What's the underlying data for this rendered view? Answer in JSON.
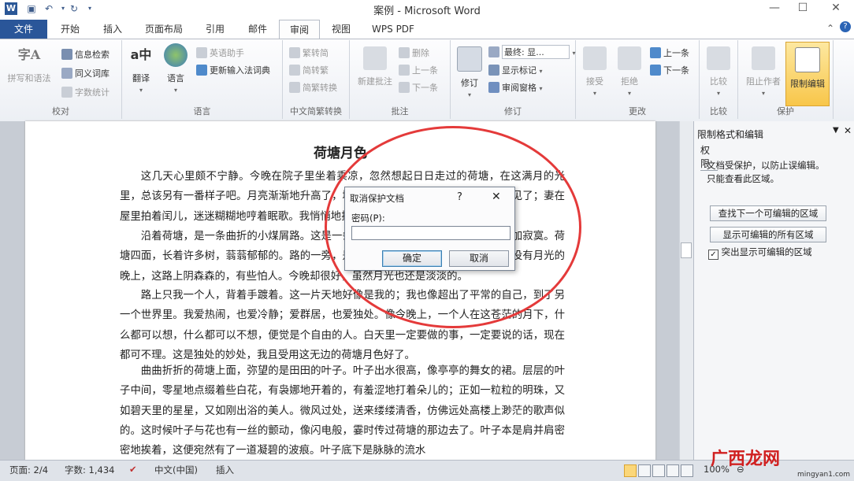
{
  "window": {
    "title": "案例 - Microsoft Word",
    "app_icon": "W",
    "minimize": "—",
    "maximize": "☐",
    "close": "✕"
  },
  "quick_access": {
    "save_icon": "save-icon",
    "undo_icon": "undo-icon",
    "repeat_icon": "repeat-icon"
  },
  "tabs": [
    "文件",
    "开始",
    "插入",
    "页面布局",
    "引用",
    "邮件",
    "审阅",
    "视图",
    "WPS PDF"
  ],
  "active_tab": "审阅",
  "ribbon": {
    "groups": {
      "proofing": "校对",
      "language": "语言",
      "chinese_conversion": "中文简繁转换",
      "comments": "批注",
      "tracking": "修订",
      "changes": "更改",
      "compare": "比较",
      "protect": "保护"
    },
    "proofing": {
      "spelling": "拼写和语法",
      "research": "信息检索",
      "thesaurus": "同义词库",
      "word_count": "字数统计"
    },
    "language": {
      "translate": "翻译",
      "language": "语言",
      "english_assistant": "英语助手",
      "update_ime": "更新输入法词典"
    },
    "conversion": {
      "to_simplified": "繁转简",
      "to_traditional": "简转繁",
      "convert": "简繁转换"
    },
    "comments": {
      "new_comment": "新建批注",
      "delete": "删除",
      "previous": "上一条",
      "next": "下一条"
    },
    "tracking": {
      "track_changes": "修订",
      "final_display": "最终: 显...",
      "show_markup": "显示标记",
      "review_pane": "审阅窗格"
    },
    "changes": {
      "accept": "接受",
      "reject": "拒绝",
      "previous": "上一条",
      "next": "下一条"
    },
    "compare": {
      "compare": "比较"
    },
    "protect": {
      "block_authors": "阻止作者",
      "restrict_editing": "限制编辑"
    }
  },
  "document": {
    "title": "荷塘月色",
    "paragraphs": [
      "这几天心里颇不宁静。今晚在院子里坐着乘凉，忽然想起日日走过的荷塘，在这满月的光里，总该另有一番样子吧。月亮渐渐地升高了，墙外马路上孩子们的欢笑，已经听不见了；妻在屋里拍着闰儿，迷迷糊糊地哼着眠歌。我悄悄地披了大衫，带上门出去。",
      "沿着荷塘，是一条曲折的小煤屑路。这是一条幽僻的路；白天也少人走，夜晚更加寂寞。荷塘四面，长着许多树，蓊蓊郁郁的。路的一旁，是些杨柳，和一些不知道名字的树。没有月光的晚上，这路上阴森森的，有些怕人。今晚却很好，虽然月光也还是淡淡的。",
      "路上只我一个人，背着手踱着。这一片天地好像是我的；我也像超出了平常的自己，到了另一个世界里。我爱热闹，也爱冷静；爱群居，也爱独处。像今晚上，一个人在这苍茫的月下，什么都可以想，什么都可以不想，便觉是个自由的人。白天里一定要做的事，一定要说的话，现在都可不理。这是独处的妙处，我且受用这无边的荷塘月色好了。",
      "曲曲折折的荷塘上面，弥望的是田田的叶子。叶子出水很高，像亭亭的舞女的裙。层层的叶子中间，零星地点缀着些白花，有袅娜地开着的，有羞涩地打着朵儿的；正如一粒粒的明珠，又如碧天里的星星，又如刚出浴的美人。微风过处，送来缕缕清香，仿佛远处高楼上渺茫的歌声似的。这时候叶子与花也有一丝的颤动，像闪电般，霎时传过荷塘的那边去了。叶子本是肩并肩密密地挨着，这便宛然有了一道凝碧的波痕。叶子底下是脉脉的流水"
    ]
  },
  "dialog": {
    "title": "取消保护文档",
    "help": "?",
    "close": "✕",
    "password_label": "密码(P):",
    "password_value": "",
    "ok": "确定",
    "cancel": "取消"
  },
  "task_pane": {
    "title": "限制格式和编辑",
    "section": "权限",
    "description_1": "文档受保护，以防止误编辑。",
    "description_2": "只能查看此区域。",
    "find_next_region": "查找下一个可编辑的区域",
    "show_all_regions": "显示可编辑的所有区域",
    "highlight_label": "突出显示可编辑的区域",
    "highlight_checked": true
  },
  "status_bar": {
    "page": "页面: 2/4",
    "words": "字数: 1,434",
    "language": "中文(中国)",
    "mode": "插入",
    "zoom": "100%"
  },
  "watermark": {
    "main": "广西龙网",
    "sub": "mingyan1.com"
  }
}
